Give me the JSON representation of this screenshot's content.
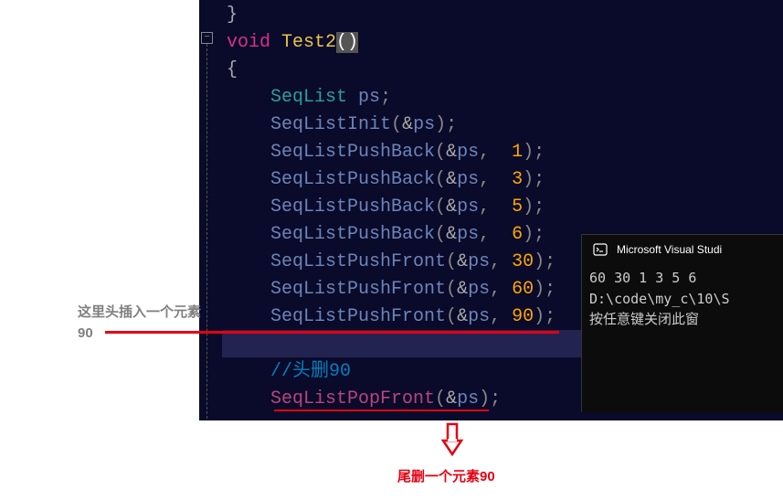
{
  "annotations": {
    "left_line1": "这里头插入一个元素",
    "left_line2": "90",
    "bottom": "尾删一个元素90"
  },
  "gutter": {
    "fold_symbol": "−"
  },
  "code": {
    "line1_brace": "}",
    "line2_kw": "void",
    "line2_func": "Test2",
    "line2_parens": "()",
    "line3_brace": "{",
    "line4_type": "SeqList",
    "line4_var": "ps",
    "line4_semi": ";",
    "line5_func": "SeqListInit",
    "line5_open": "(",
    "line5_amp": "&",
    "line5_var": "ps",
    "line5_close": ")",
    "line5_semi": ";",
    "pushback": "SeqListPushBack",
    "pushfront": "SeqListPushFront",
    "popfront": "SeqListPopFront",
    "amp": "&",
    "ps": "ps",
    "comma": ",",
    "open": "(",
    "close": ")",
    "semi": ";",
    "n1": "1",
    "n3": "3",
    "n5": "5",
    "n6": "6",
    "n30": "30",
    "n60": "60",
    "n90": "90",
    "comment": "//头删90"
  },
  "console": {
    "title": "Microsoft Visual Studi",
    "line1": "60 30 1 3 5 6",
    "line2": "D:\\code\\my_c\\10\\S",
    "line3": "按任意键关闭此窗"
  }
}
